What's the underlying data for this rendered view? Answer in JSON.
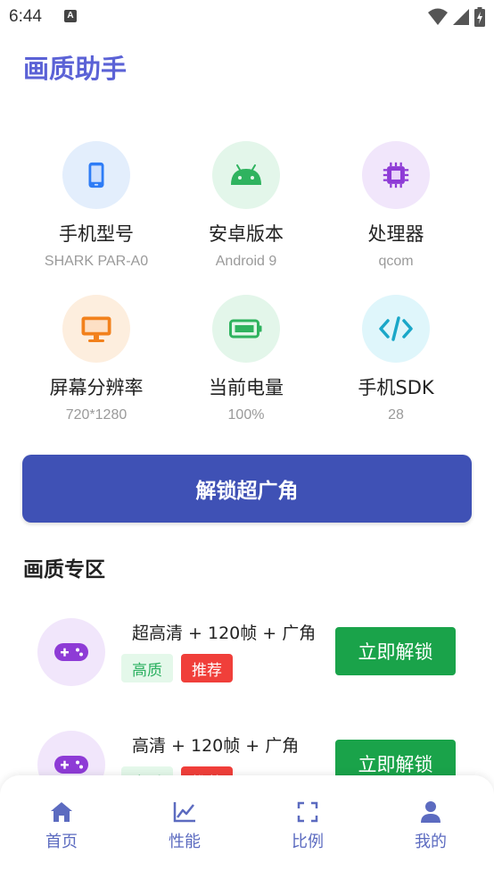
{
  "status_bar": {
    "time": "6:44",
    "notif_glyph": "A"
  },
  "app": {
    "title": "画质助手"
  },
  "device_info": [
    {
      "label": "手机型号",
      "value": "SHARK PAR-A0",
      "icon": "phone-icon",
      "icon_bg": "#e3eefc",
      "icon_color": "#2e7cf6"
    },
    {
      "label": "安卓版本",
      "value": "Android 9",
      "icon": "android-icon",
      "icon_bg": "#e3f6ea",
      "icon_color": "#2fb35f"
    },
    {
      "label": "处理器",
      "value": "qcom",
      "icon": "chip-icon",
      "icon_bg": "#f1e6fb",
      "icon_color": "#8e3bd6"
    },
    {
      "label": "屏幕分辨率",
      "value": "720*1280",
      "icon": "monitor-icon",
      "icon_bg": "#fdeede",
      "icon_color": "#f2811c"
    },
    {
      "label": "当前电量",
      "value": "100%",
      "icon": "battery-icon",
      "icon_bg": "#e3f6ea",
      "icon_color": "#2fb35f"
    },
    {
      "label": "手机SDK",
      "value": "28",
      "icon": "code-icon",
      "icon_bg": "#dff6fb",
      "icon_color": "#1aa7c8"
    }
  ],
  "unlock_wide_label": "解锁超广角",
  "section": {
    "title": "画质专区"
  },
  "quality_items": [
    {
      "title": "超高清 + 120帧 + 广角",
      "tags": [
        "高质",
        "推荐"
      ],
      "button": "立即解锁"
    },
    {
      "title": "高清 + 120帧 + 广角",
      "tags": [
        "高质",
        "推荐"
      ],
      "button": "立即解锁"
    }
  ],
  "bottom_nav": [
    {
      "label": "首页",
      "icon": "home-icon"
    },
    {
      "label": "性能",
      "icon": "chart-icon"
    },
    {
      "label": "比例",
      "icon": "fullscreen-icon"
    },
    {
      "label": "我的",
      "icon": "user-icon"
    }
  ],
  "colors": {
    "accent": "#3f51b5",
    "title": "#5b62d6",
    "unlock_green": "#1aa34a",
    "nav": "#5c6bc0",
    "tag_red": "#f03f3a"
  }
}
